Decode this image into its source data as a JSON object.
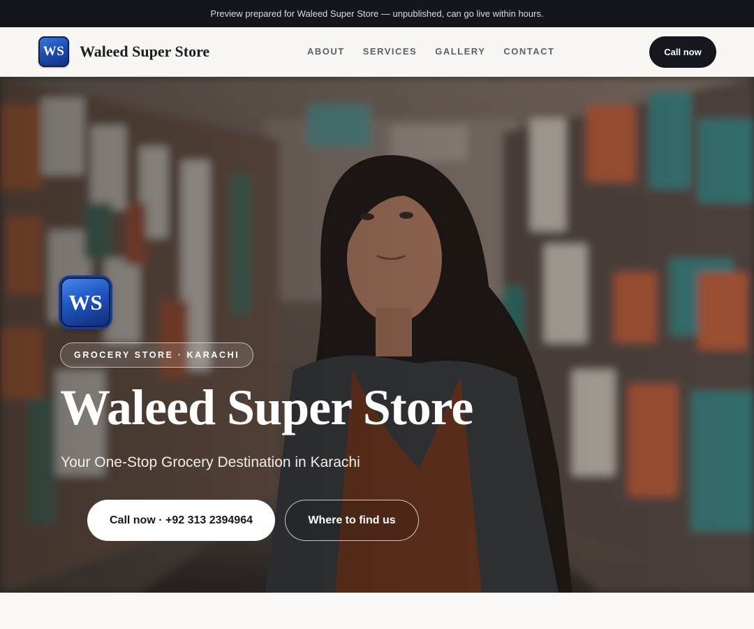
{
  "topbar": {
    "notice": "Preview prepared for Waleed Super Store — unpublished, can go live within hours."
  },
  "nav": {
    "logo_text": "WS",
    "brand": "Waleed Super Store",
    "links": [
      "ABOUT",
      "SERVICES",
      "GALLERY",
      "CONTACT"
    ],
    "cta": "Call now"
  },
  "hero": {
    "logo_text": "WS",
    "tag": "GROCERY STORE · KARACHI",
    "title": "Waleed Super Store",
    "subtitle": "Your One-Stop Grocery Destination in Karachi",
    "primary_button": "Call now · +92 313 2394964",
    "secondary_button": "Where to find us"
  },
  "colors": {
    "topbar_bg": "#14161b",
    "page_bg": "#f8f7f4",
    "dark_button": "#15171c",
    "logo_blue": "#1d4fb5"
  }
}
